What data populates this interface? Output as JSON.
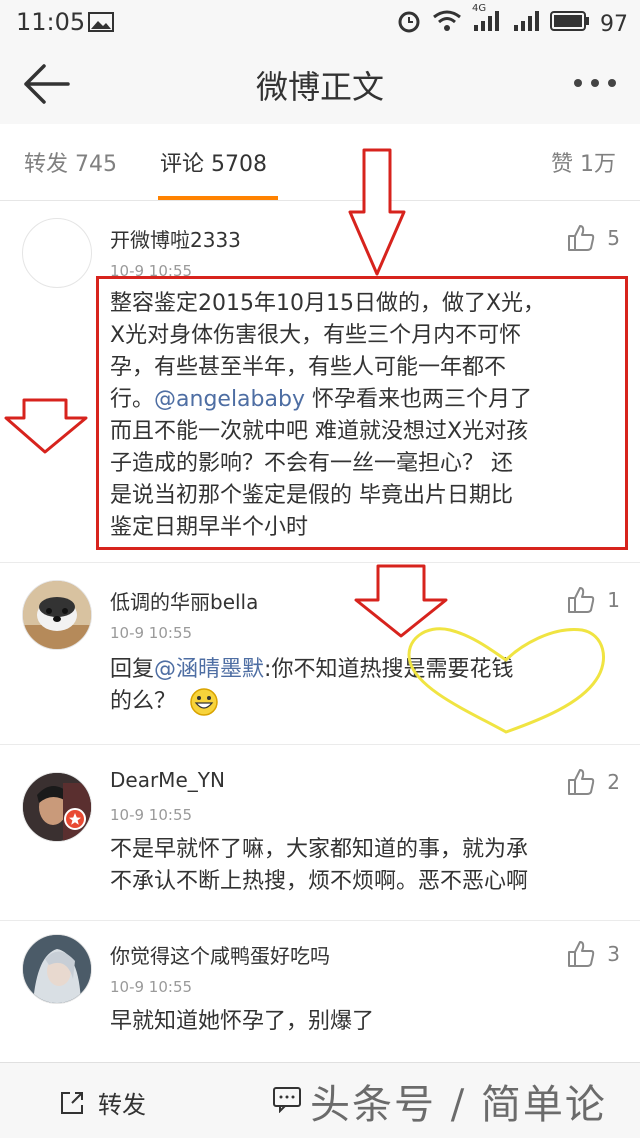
{
  "status": {
    "time": "11:05",
    "battery": "97",
    "network": "4G"
  },
  "nav": {
    "title": "微博正文"
  },
  "tabs": {
    "repost": "转发 745",
    "comment": "评论 5708",
    "like": "赞 1万"
  },
  "comments": [
    {
      "user": "开微博啦2333",
      "time": "10-9 10:55",
      "likes": "5",
      "lines": [
        "整容鉴定2015年10月15日做的，做了X光，",
        "X光对身体伤害很大，有些三个月内不可怀",
        "孕，有些甚至半年，有些人可能一年都不"
      ],
      "line4_pre": "行。",
      "line4_mention": "@angelababy",
      "line4_post": " 怀孕看来也两三个月了",
      "lines_after": [
        "而且不能一次就中吧 难道就没想过X光对孩",
        "子造成的影响？不会有一丝一毫担心？ 还",
        "是说当初那个鉴定是假的 毕竟出片日期比",
        "鉴定日期早半个小时"
      ]
    },
    {
      "user": "低调的华丽bella",
      "time": "10-9 10:55",
      "likes": "1",
      "reply_pre": "回复",
      "reply_mention": "@涵晴墨默",
      "reply_text": ":你不知道热搜是需要花钱",
      "reply_line2": "的么？"
    },
    {
      "user": "DearMe_YN",
      "time": "10-9 10:55",
      "likes": "2",
      "lines": [
        "不是早就怀了嘛，大家都知道的事，就为承",
        "不承认不断上热搜，烦不烦啊。恶不恶心啊"
      ]
    },
    {
      "user": "你觉得这个咸鸭蛋好吃吗",
      "time": "10-9 10:55",
      "likes": "3",
      "lines": [
        "早就知道她怀孕了，别爆了"
      ]
    }
  ],
  "bottom": {
    "repost": "转发"
  },
  "watermark": "头条号 / 简单论",
  "colors": {
    "accent": "#ff8200",
    "mention": "#4e6ea3",
    "annotation_red": "#d7231d",
    "annotation_yellow": "#f0e442"
  }
}
